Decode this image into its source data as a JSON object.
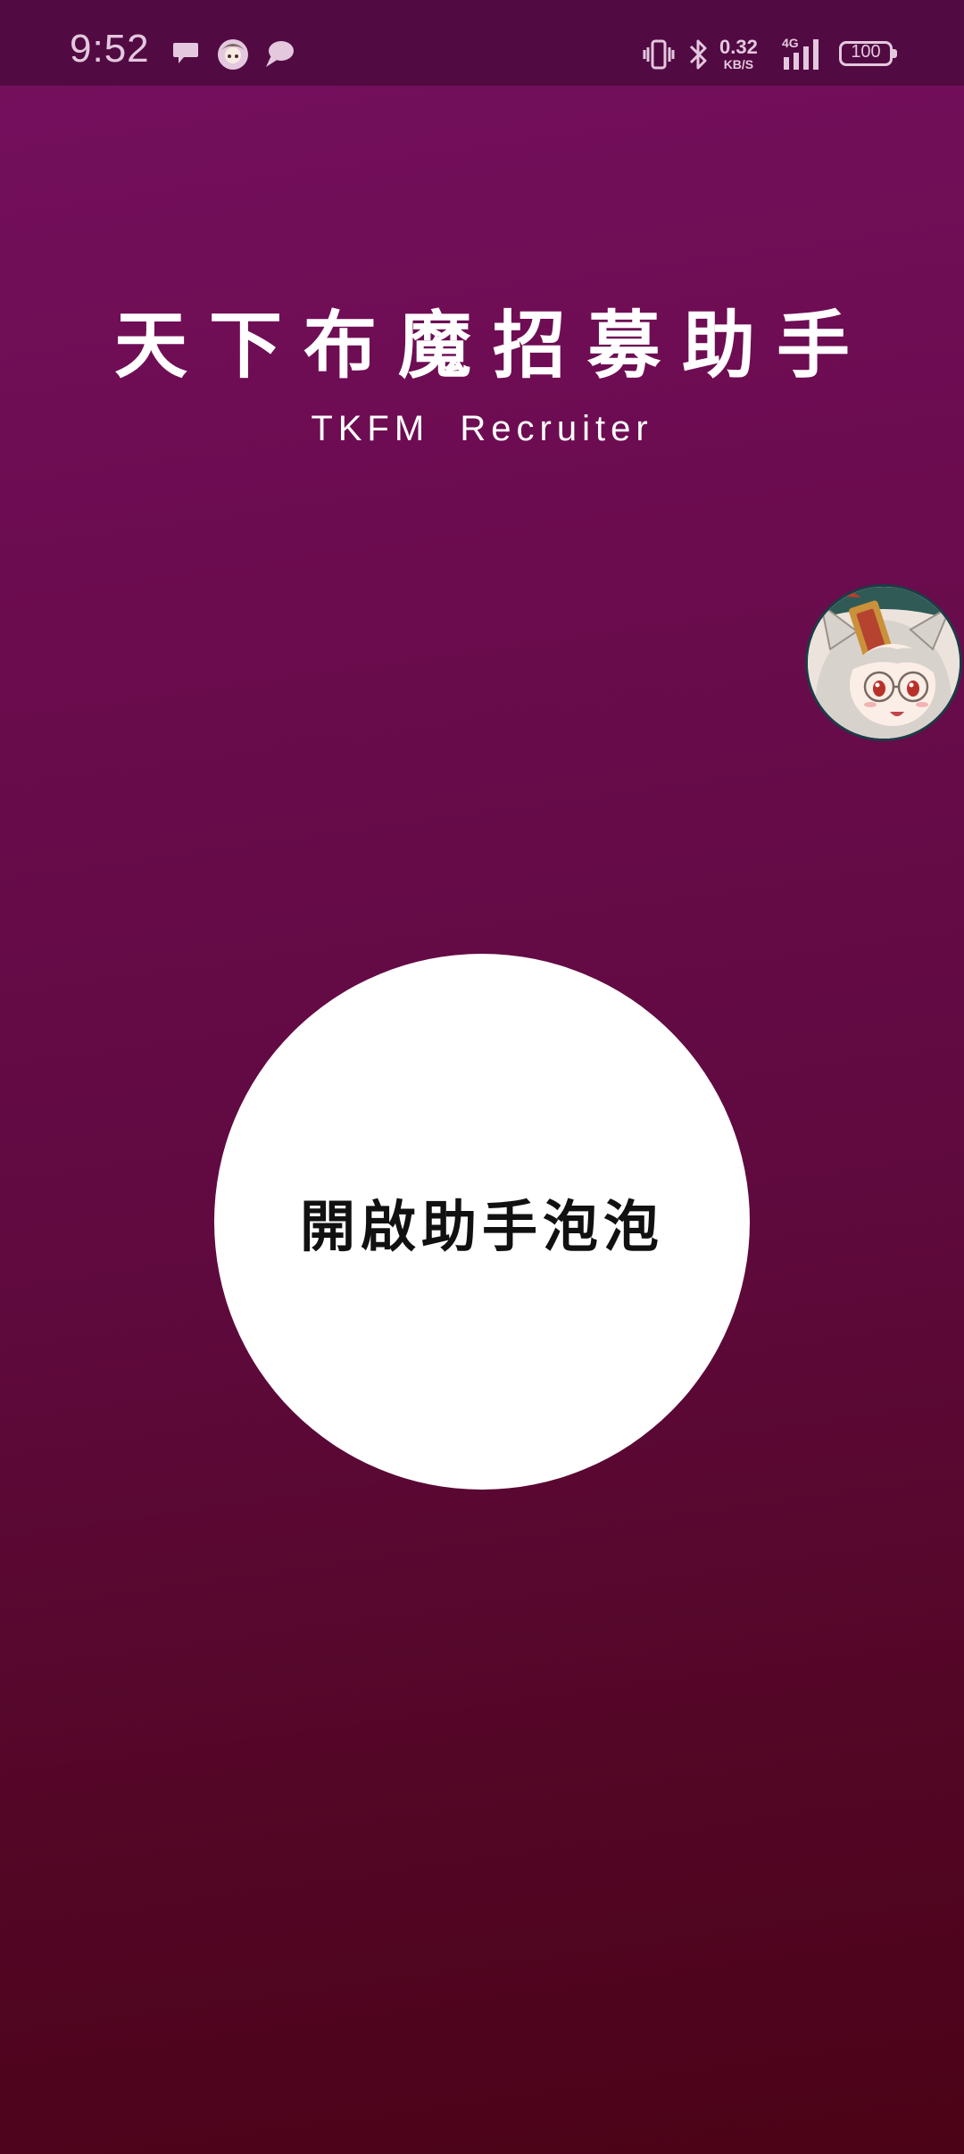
{
  "status_bar": {
    "time": "9:52",
    "net_speed_value": "0.32",
    "net_speed_unit": "KB/S",
    "network_type": "4G",
    "battery_level": "100",
    "notification_icons": [
      "chat-bubble-icon",
      "avatar-notification-icon",
      "chat-bubble-icon"
    ],
    "right_icons": [
      "vibrate-icon",
      "bluetooth-icon",
      "signal-4g-icon",
      "battery-icon"
    ]
  },
  "header": {
    "title": "天下布魔招募助手",
    "subtitle": "TKFM  Recruiter"
  },
  "floating_bubble": {
    "icon": "anime-character-avatar-icon"
  },
  "main_button": {
    "label": "開啟助手泡泡"
  },
  "colors": {
    "background_top": "#75105f",
    "background_bottom": "#4b0317",
    "status_bar": "#520a42",
    "button": "#ffffff",
    "button_text": "#111111"
  }
}
